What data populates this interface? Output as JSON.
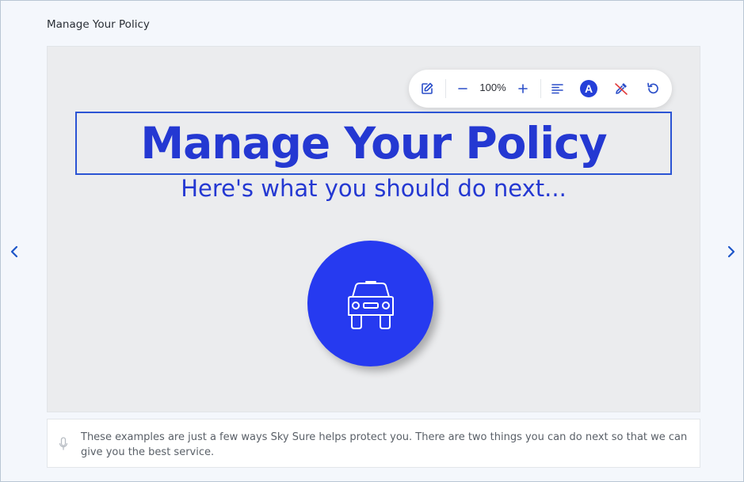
{
  "page": {
    "title": "Manage Your Policy"
  },
  "nav": {
    "prev_icon": "chevron-left-icon",
    "next_icon": "chevron-right-icon"
  },
  "toolbar": {
    "zoom_label": "100%",
    "font_badge_label": "A",
    "icons": [
      "edit-icon",
      "zoom-out-icon",
      "zoom-in-icon",
      "align-left-icon",
      "font-color-icon",
      "eyedropper-off-icon",
      "undo-icon"
    ]
  },
  "slide": {
    "heading": "Manage Your Policy",
    "subheading": "Here's what you should do next...",
    "illustration_icon": "car-icon"
  },
  "caption": {
    "text": "These examples are just a few ways Sky Sure helps protect you. There are two things you can do next so that we can give you the best service."
  },
  "colors": {
    "accent": "#2438d2",
    "circle": "#263af0",
    "slide_bg": "#ebecee"
  }
}
